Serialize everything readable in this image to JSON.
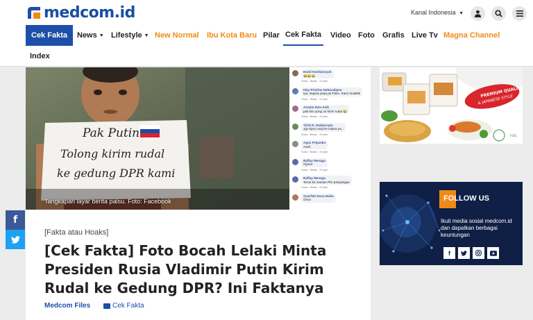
{
  "header": {
    "logo_text": "medcom.id",
    "channel_label": "Kanal Indonesia",
    "brand_color": "#1e4fa8",
    "accent_color": "#f08a17"
  },
  "nav": {
    "active": "Cek Fakta",
    "items": [
      {
        "label": "News",
        "has_dropdown": true
      },
      {
        "label": "Lifestyle",
        "has_dropdown": true
      },
      {
        "label": "New Normal",
        "highlight": true
      },
      {
        "label": "Ibu Kota Baru",
        "highlight": true
      },
      {
        "label": "Pilar"
      },
      {
        "label": "Cek Fakta",
        "current": true
      },
      {
        "label": "Video"
      },
      {
        "label": "Foto"
      },
      {
        "label": "Grafis"
      },
      {
        "label": "Live Tv"
      },
      {
        "label": "Magna Channel",
        "highlight": true
      }
    ],
    "second_row": "Index"
  },
  "article": {
    "photo_caption": "Tangkapan layar berita palsu. Foto: Facebook",
    "sign_lines": [
      "Pak Putin",
      "Tolong kirim rudal",
      "ke gedung DPR kami"
    ],
    "kicker": "[Fakta atau Hoaks]",
    "headline": "[Cek Fakta] Foto Bocah Lelaki Minta Presiden Rusia Vladimir Putin Kirim Rudal ke Gedung DPR? Ini Faktanya",
    "author": "Medcom Files",
    "category": "Cek Fakta"
  },
  "comments": [
    {
      "name": "Hardi Hardiansyah",
      "text": "😂😂😂",
      "meta": "Suka · Balas · 22 jam"
    },
    {
      "name": "Iday Pristina Nafasadjana",
      "text": "Iya, segera yaaa pa Putin. Kami muakkk",
      "meta": "Suka · Balas · 22 jam"
    },
    {
      "name": "Ananta Ilam Anik",
      "text": "pak kim yong un kirim rudal 😂",
      "meta": "Suka · Balas · 20 jam"
    },
    {
      "name": "Tiirik R. Dwikarnata",
      "text": "Jgn kpra Lenjt ke istana ya...",
      "meta": "Suka · Balas · 20 jam"
    },
    {
      "name": "Agus Prijambo",
      "text": "Aseli.",
      "meta": "Suka · Balas · 20 jam"
    },
    {
      "name": "Byflay Mesaga",
      "text": "Oyeee",
      "meta": "Suka · Balas · 20 jam"
    },
    {
      "name": "Byflay Mesaga",
      "text": "Terus ke mantan PKI perjuangan",
      "meta": "Suka · Balas · 20 jam"
    },
    {
      "name": "Syarifah Nova Mulia",
      "text": "Geoo",
      "meta": ""
    }
  ],
  "share": {
    "facebook_color": "#3b5998",
    "twitter_color": "#1da1f2"
  },
  "sidebar": {
    "ad_badge": "PREMIUM QUALITY & JAPANESE STYLE",
    "follow_title": "FOLLOW US",
    "follow_text": "Ikuti media sosial medcom.id dan dapatkan berbagai keuntungan"
  }
}
